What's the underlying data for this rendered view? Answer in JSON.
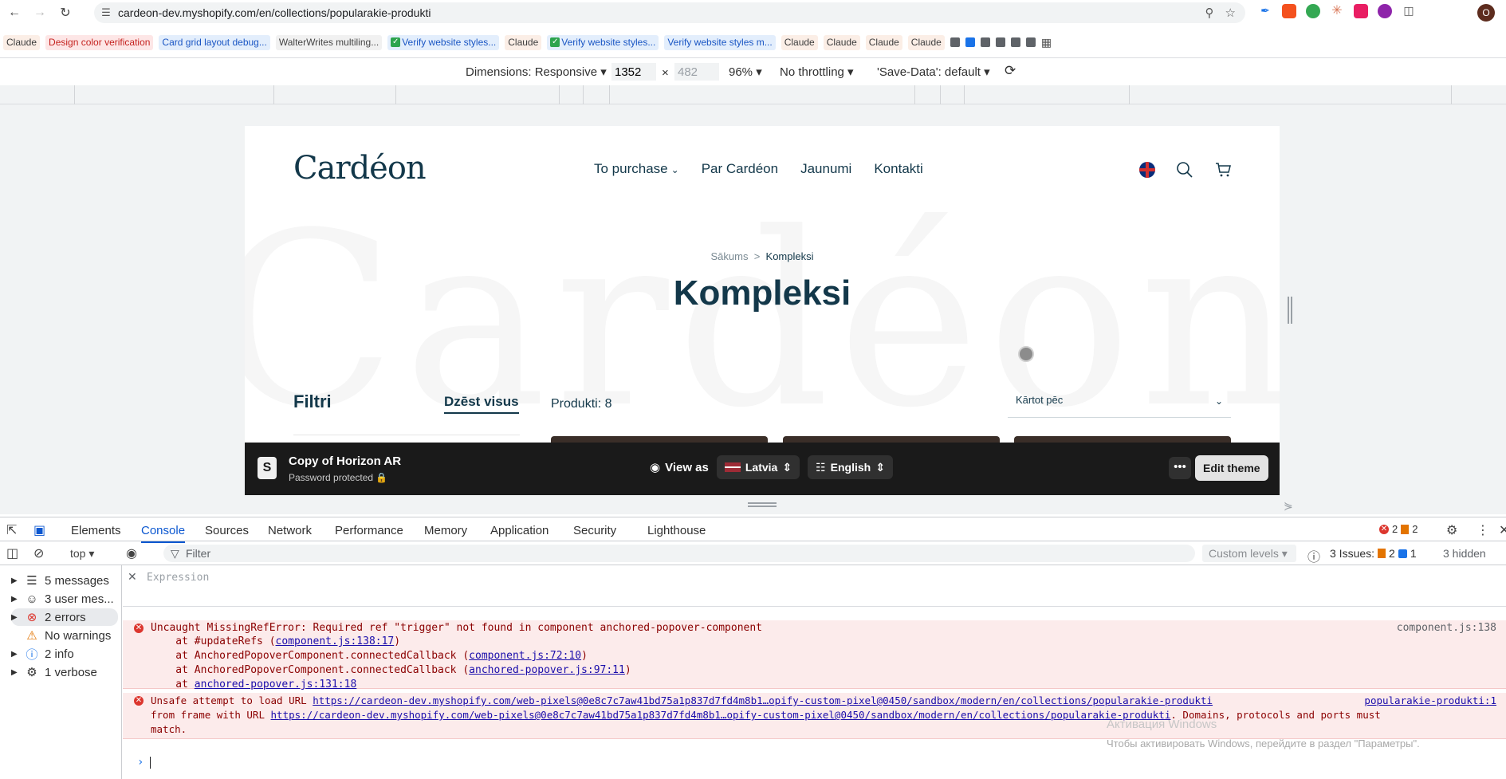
{
  "browser": {
    "url": "cardeon-dev.myshopify.com/en/collections/popularakie-produkti",
    "profile_initial": "O",
    "bookmarks": [
      {
        "label": "Claude",
        "style": "plain"
      },
      {
        "label": "Design color verification",
        "style": "red"
      },
      {
        "label": "Card grid layout debug...",
        "style": "blue"
      },
      {
        "label": "WalterWrites multiling...",
        "style": "gray"
      },
      {
        "label": "Verify website styles...",
        "style": "blue",
        "check": true
      },
      {
        "label": "Claude",
        "style": "plain"
      },
      {
        "label": "Verify website styles...",
        "style": "blue",
        "check": true
      },
      {
        "label": "Verify website styles m...",
        "style": "blue"
      },
      {
        "label": "Claude",
        "style": "plain"
      },
      {
        "label": "Claude",
        "style": "plain"
      },
      {
        "label": "Claude",
        "style": "plain"
      },
      {
        "label": "Claude",
        "style": "plain"
      }
    ]
  },
  "device_toolbar": {
    "dimensions": "Dimensions: Responsive",
    "width": "1352",
    "height": "482",
    "zoom": "96%",
    "throttling": "No throttling",
    "save_data": "'Save-Data': default",
    "times": "×"
  },
  "site": {
    "logo": "Cardéon",
    "watermark": "Cardéon",
    "nav": [
      "To purchase",
      "Par Cardéon",
      "Jaunumi",
      "Kontakti"
    ],
    "breadcrumb_home": "Sākums",
    "breadcrumb_sep": ">",
    "breadcrumb_current": "Kompleksi",
    "title": "Kompleksi",
    "filters_title": "Filtri",
    "clear_all": "Dzēst visus",
    "product_count": "Produkti: 8",
    "sort_label": "Kārtot pēc"
  },
  "preview_bar": {
    "theme_name": "Copy of Horizon AR",
    "status": "Password protected",
    "view_as": "View as",
    "country": "Latvia",
    "language": "English",
    "more": "•••",
    "edit": "Edit theme"
  },
  "devtools": {
    "tabs": [
      "Elements",
      "Console",
      "Sources",
      "Network",
      "Performance",
      "Memory",
      "Application",
      "Security",
      "Lighthouse"
    ],
    "active_tab": "Console",
    "error_count": "2",
    "warning_count": "2",
    "context": "top",
    "filter_placeholder": "Filter",
    "levels": "Custom levels",
    "issues_label": "3 Issues:",
    "issues_warn": "2",
    "issues_info": "1",
    "hidden": "3 hidden",
    "sidebar": [
      {
        "label": "5 messages",
        "icon": "list-icon"
      },
      {
        "label": "3 user mes...",
        "icon": "user-icon"
      },
      {
        "label": "2 errors",
        "icon": "error-icon"
      },
      {
        "label": "No warnings",
        "icon": "warning-icon"
      },
      {
        "label": "2 info",
        "icon": "info-icon"
      },
      {
        "label": "1 verbose",
        "icon": "bug-icon"
      }
    ],
    "expression_placeholder": "Expression",
    "errors": [
      {
        "lines": [
          "Uncaught MissingRefError: Required ref \"trigger\" not found in component anchored-popover-component",
          "    at #updateRefs (",
          "    at AnchoredPopoverComponent.connectedCallback (",
          "    at AnchoredPopoverComponent.connectedCallback (",
          "    at "
        ],
        "links": [
          "component.js:138:17",
          "component.js:72:10",
          "anchored-popover.js:97:11",
          "anchored-popover.js:131:18"
        ],
        "source": "component.js:138"
      },
      {
        "line1_prefix": "Unsafe attempt to load URL ",
        "url1": "https://cardeon-dev.myshopify.com/web-pixels@0e8c7c7aw41bd75a1p837d7fd4m8b1…opify-custom-pixel@0450/sandbox/modern/en/collections/popularakie-produkti",
        "line2_prefix": "from frame with URL ",
        "url2": "https://cardeon-dev.myshopify.com/web-pixels@0e8c7c7aw41bd75a1p837d7fd4m8b1…opify-custom-pixel@0450/sandbox/modern/en/collections/popularakie-produkti",
        "line2_suffix": ". Domains, protocols and ports must",
        "line3": "match.",
        "source": "popularakie-produkti:1"
      }
    ]
  },
  "os_watermark": {
    "title": "Активация Windows",
    "text": "Чтобы активировать Windows, перейдите в раздел \"Параметры\"."
  }
}
